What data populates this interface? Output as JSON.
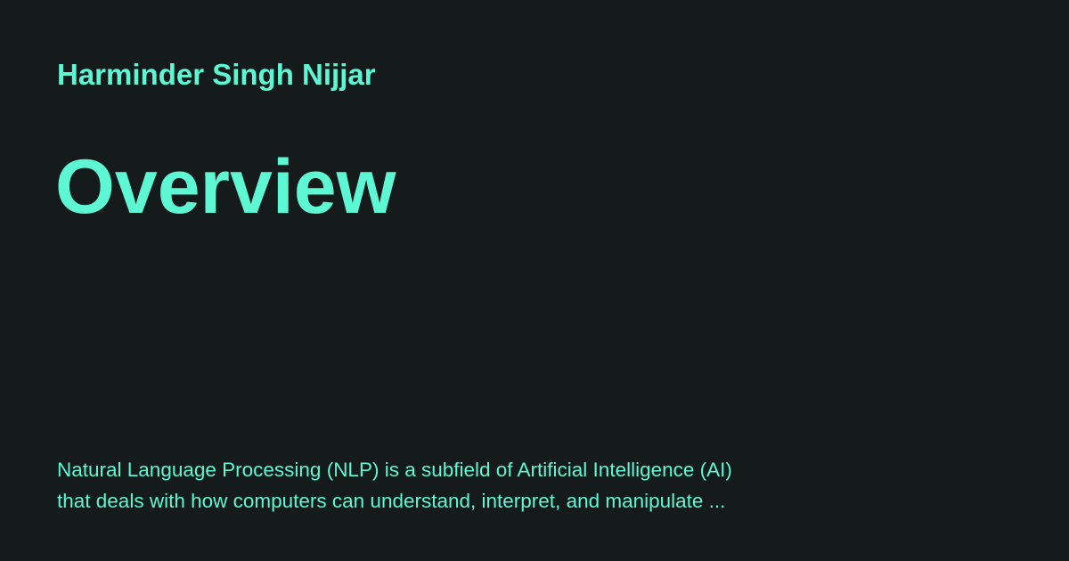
{
  "card": {
    "author": "Harminder Singh Nijjar",
    "title": "Overview",
    "excerpt_lines": [
      "Natural Language Processing (NLP) is a subfield of Artificial Intelligence (AI)",
      "that deals with how computers can understand, interpret, and manipulate ..."
    ]
  },
  "colors": {
    "background": "#151a1b",
    "accent": "#5ef7d4"
  }
}
